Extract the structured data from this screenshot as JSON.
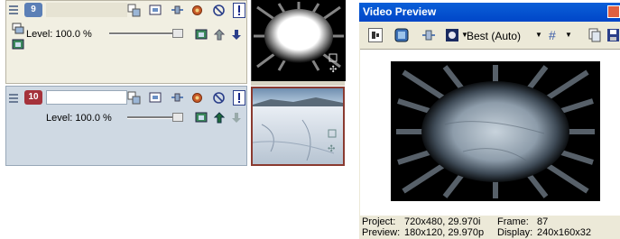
{
  "tracks": [
    {
      "number": "9",
      "level_label": "Level: 100.0 %",
      "number_color": "#5b7fb6"
    },
    {
      "number": "10",
      "level_label": "Level: 100.0 %",
      "number_color": "#a5323b"
    }
  ],
  "preview": {
    "title": "Video Preview",
    "quality": "Best (Auto)",
    "project_label": "Project:",
    "project_value": "720x480, 29.970i",
    "frame_label": "Frame:",
    "frame_value": "87",
    "preview_label": "Preview:",
    "preview_value": "180x120, 29.970p",
    "display_label": "Display:",
    "display_value": "240x160x32"
  },
  "colors": {
    "track9_bg": "#f1efe2",
    "track10_bg": "#cfd9e3",
    "titlebar": "#0a5fd8",
    "status_red": "#a00000"
  }
}
